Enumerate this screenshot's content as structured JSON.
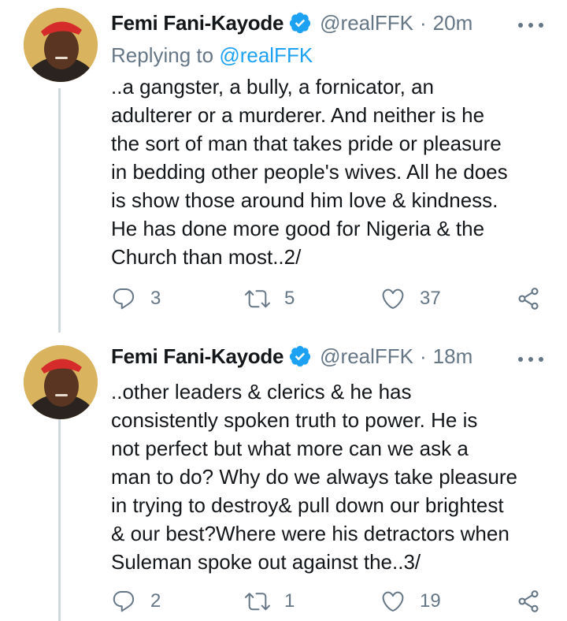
{
  "tweets": [
    {
      "author": {
        "name": "Femi Fani-Kayode",
        "handle": "@realFFK"
      },
      "time": "20m",
      "separator": "·",
      "reply": {
        "prefix": "Replying to",
        "to": "@realFFK"
      },
      "lines": [
        "..a gangster, a bully, a fornicator, an",
        "adulterer or a murderer. And neither is he",
        "the sort of man that takes pride or pleasure",
        "in bedding other people's wives. All he does",
        "is show those around him love & kindness.",
        "He has done more good for Nigeria & the",
        "Church than most..2/"
      ],
      "counts": {
        "replies": "3",
        "retweets": "5",
        "likes": "37"
      }
    },
    {
      "author": {
        "name": "Femi Fani-Kayode",
        "handle": "@realFFK"
      },
      "time": "18m",
      "separator": "·",
      "lines": [
        "..other leaders & clerics & he has",
        "consistently spoken truth to power. He is",
        "not perfect but what more can we ask a",
        "man to do? Why do we always take pleasure",
        "in trying to destroy& pull down our brightest",
        "& our best?Where were his detractors when",
        "Suleman spoke out against the..3/"
      ],
      "counts": {
        "replies": "2",
        "retweets": "1",
        "likes": "19"
      }
    }
  ],
  "colors": {
    "text": "#14171a",
    "secondary": "#657786",
    "accent": "#1da1f2",
    "thread_line": "#cfd9de",
    "verified": "#1da1f2"
  },
  "icons": [
    "verified-badge-icon",
    "more-icon",
    "reply-icon",
    "retweet-icon",
    "like-icon",
    "share-icon"
  ]
}
